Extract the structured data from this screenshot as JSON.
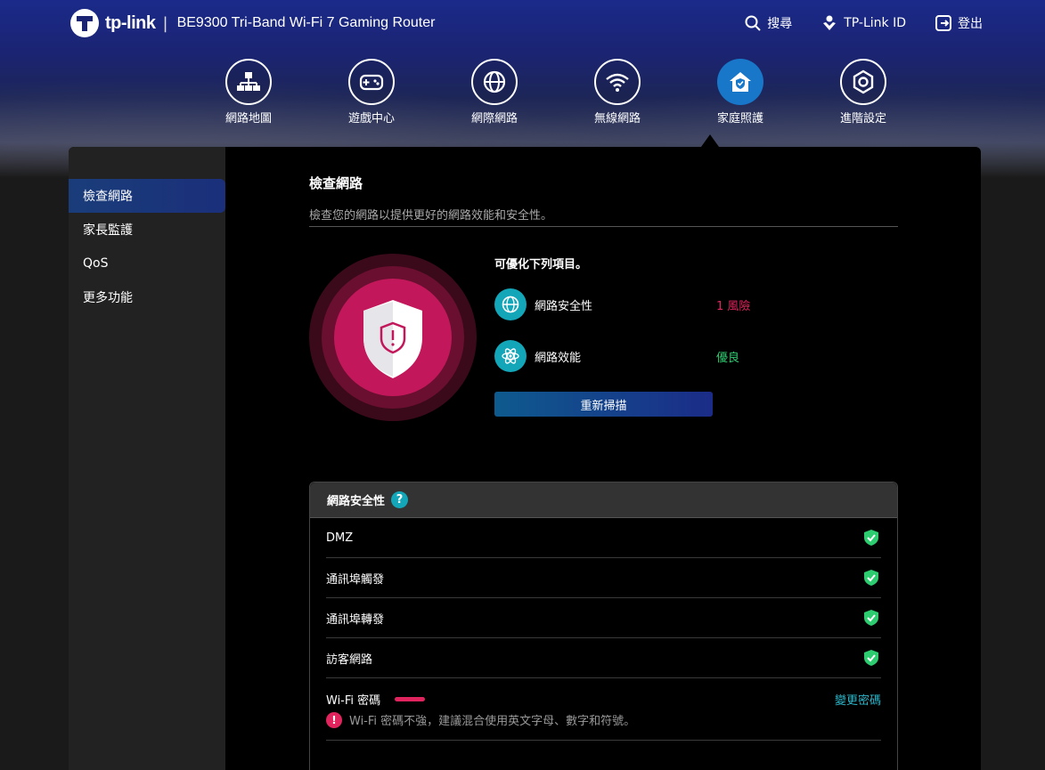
{
  "header": {
    "brand": "tp-link",
    "separator": "|",
    "model": "BE9300 Tri-Band Wi-Fi 7 Gaming Router",
    "actions": [
      {
        "label": "搜尋",
        "icon": "search-icon"
      },
      {
        "label": "TP-Link ID",
        "icon": "tplink-id-icon"
      },
      {
        "label": "登出",
        "icon": "logout-icon"
      }
    ]
  },
  "nav": {
    "items": [
      {
        "label": "網路地圖",
        "icon": "network-map-icon"
      },
      {
        "label": "遊戲中心",
        "icon": "gamepad-icon"
      },
      {
        "label": "網際網路",
        "icon": "globe-icon"
      },
      {
        "label": "無線網路",
        "icon": "wifi-icon"
      },
      {
        "label": "家庭照護",
        "icon": "home-care-icon",
        "active": true
      },
      {
        "label": "進階設定",
        "icon": "gear-icon"
      }
    ]
  },
  "sidebar": {
    "items": [
      {
        "label": "檢查網路",
        "active": true
      },
      {
        "label": "家長監護"
      },
      {
        "label": "QoS"
      },
      {
        "label": "更多功能"
      }
    ]
  },
  "main": {
    "title": "檢查網路",
    "subtitle": "檢查您的網路以提供更好的網路效能和安全性。",
    "summary_title": "可優化下列項目。",
    "summary": [
      {
        "label": "網路安全性",
        "status": "1 風險",
        "icon": "globe-icon",
        "status_color": "#e0245e"
      },
      {
        "label": "網路效能",
        "status": "優良",
        "icon": "atom-icon",
        "status_color": "#2ecc71"
      }
    ],
    "rescan_label": "重新掃描",
    "shield_color": "#c2185b"
  },
  "security": {
    "title": "網路安全性",
    "help": "?",
    "rows": [
      {
        "label": "DMZ",
        "ok": true
      },
      {
        "label": "通訊埠觸發",
        "ok": true
      },
      {
        "label": "通訊埠轉發",
        "ok": true
      },
      {
        "label": "訪客網路",
        "ok": true
      }
    ],
    "wifi": {
      "label": "Wi-Fi 密碼",
      "change_label": "變更密碼",
      "warning_icon": "!",
      "warning": "Wi-Fi 密碼不強，建議混合使用英文字母、數字和符號。"
    }
  }
}
